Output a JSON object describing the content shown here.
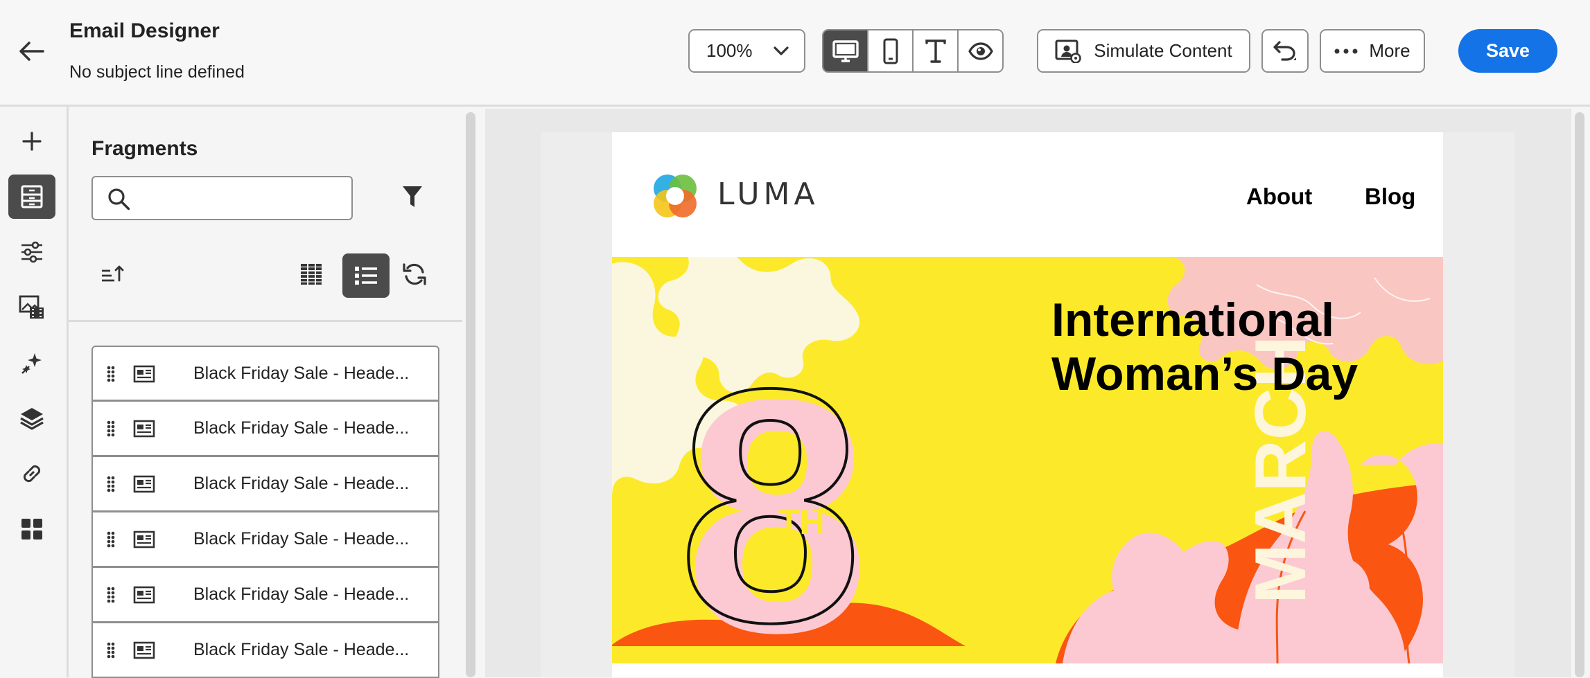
{
  "header": {
    "app_title": "Email Designer",
    "subject": "No subject line defined",
    "zoom_value": "100%",
    "simulate_label": "Simulate Content",
    "more_label": "More",
    "save_label": "Save"
  },
  "toolbar": {
    "view_modes": [
      "desktop-icon",
      "mobile-icon",
      "text-icon",
      "preview-icon"
    ],
    "active_view": "desktop"
  },
  "left_rail": {
    "items": [
      "plus-icon",
      "fragments-icon",
      "settings-sliders-icon",
      "assets-icon",
      "ai-sparkle-icon",
      "layers-icon",
      "link-icon",
      "components-icon"
    ],
    "active": "fragments-icon"
  },
  "fragments_panel": {
    "title": "Fragments",
    "search_value": "",
    "items": [
      {
        "label": "Black Friday Sale - Heade..."
      },
      {
        "label": "Black Friday Sale - Heade..."
      },
      {
        "label": "Black Friday Sale - Heade..."
      },
      {
        "label": "Black Friday Sale - Heade..."
      },
      {
        "label": "Black Friday Sale - Heade..."
      },
      {
        "label": "Black Friday Sale - Heade..."
      }
    ]
  },
  "email": {
    "brand": "LUMA",
    "nav": [
      "About",
      "Blog"
    ],
    "hero": {
      "number": "8",
      "ordinal": "TH",
      "month": "MARCH",
      "headline": "International Woman’s Day"
    }
  },
  "colors": {
    "accent": "#1473e6",
    "hero_yellow": "#fcea2a",
    "hero_pink": "#fccbd2",
    "hero_orange": "#fa5511",
    "active_tool": "#4b4b4b"
  }
}
